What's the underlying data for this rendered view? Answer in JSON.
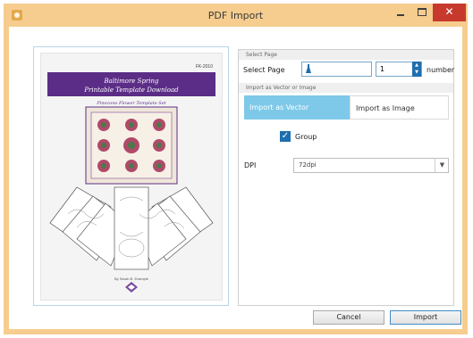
{
  "window": {
    "title": "PDF Import",
    "close_glyph": "✕"
  },
  "preview": {
    "code": "FK-2010",
    "title_line1": "Baltimore Spring",
    "title_line2": "Printable Template Download",
    "subtitle": "Pinecone Flower Template Set",
    "author": "By Sarah B. Example",
    "colors": {
      "banner": "#5b2d86",
      "accent": "#7a4aa0"
    }
  },
  "select_page": {
    "section_title": "Select Page",
    "label": "Select Page",
    "value": "1",
    "suffix": "number"
  },
  "import_mode": {
    "section_title": "Import as Vector or Image",
    "tabs": [
      {
        "label": "Import as Vector",
        "active": true
      },
      {
        "label": "Import as Image",
        "active": false
      }
    ],
    "group_label": "Group",
    "group_checked": true,
    "dpi_label": "DPI",
    "dpi_value": "72dpi"
  },
  "buttons": {
    "cancel": "Cancel",
    "import": "Import"
  },
  "colors": {
    "titlebar": "#f6cd8e",
    "close": "#c7392d",
    "tab_active": "#7ec9e9",
    "accent": "#1f6fae"
  }
}
